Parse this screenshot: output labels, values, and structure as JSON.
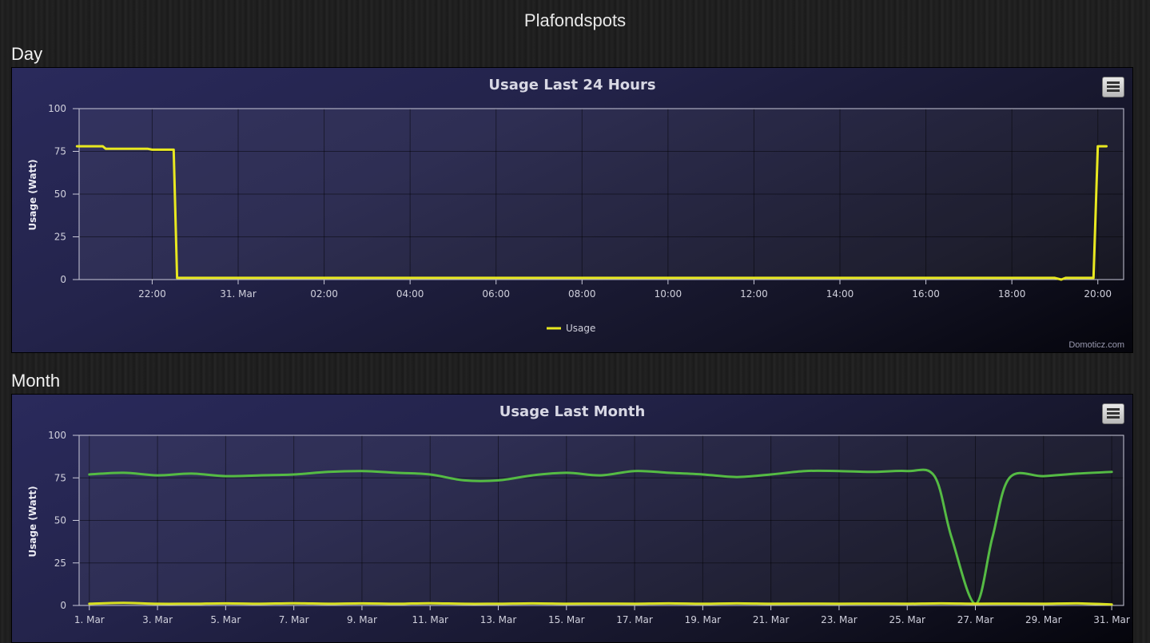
{
  "page": {
    "title": "Plafondspots"
  },
  "sections": {
    "day_label": "Day",
    "month_label": "Month"
  },
  "credit": "Domoticz.com",
  "colors": {
    "usage_day": "#e8e820",
    "usage_month_low": "#d8e020",
    "usage_month_high": "#55bb44"
  },
  "icons": {
    "menu": "hamburger-menu-icon"
  },
  "chart_data": [
    {
      "type": "line",
      "title": "Usage Last 24 Hours",
      "ylabel": "Usage (Watt)",
      "xlabel": "",
      "ylim": [
        0,
        100
      ],
      "yticks": [
        0,
        25,
        50,
        75,
        100
      ],
      "xlim_hours": [
        20.3,
        44.6
      ],
      "xticks": [
        {
          "label": "22:00",
          "hour": 22
        },
        {
          "label": "31. Mar",
          "hour": 24
        },
        {
          "label": "02:00",
          "hour": 26
        },
        {
          "label": "04:00",
          "hour": 28
        },
        {
          "label": "06:00",
          "hour": 30
        },
        {
          "label": "08:00",
          "hour": 32
        },
        {
          "label": "10:00",
          "hour": 34
        },
        {
          "label": "12:00",
          "hour": 36
        },
        {
          "label": "14:00",
          "hour": 38
        },
        {
          "label": "16:00",
          "hour": 40
        },
        {
          "label": "18:00",
          "hour": 42
        },
        {
          "label": "20:00",
          "hour": 44
        }
      ],
      "grid": true,
      "legend": "bottom-center",
      "series": [
        {
          "name": "Usage",
          "points": [
            [
              20.25,
              78
            ],
            [
              20.85,
              78
            ],
            [
              20.92,
              76.5
            ],
            [
              21.9,
              76.5
            ],
            [
              22.0,
              76
            ],
            [
              22.5,
              76
            ],
            [
              22.58,
              1
            ],
            [
              43.0,
              1
            ],
            [
              43.15,
              0
            ],
            [
              43.25,
              1
            ],
            [
              43.9,
              1
            ],
            [
              44.0,
              78
            ],
            [
              44.2,
              78
            ]
          ]
        }
      ]
    },
    {
      "type": "line",
      "title": "Usage Last Month",
      "ylabel": "Usage (Watt)",
      "xlabel": "",
      "ylim": [
        0,
        100
      ],
      "yticks": [
        0,
        25,
        50,
        75,
        100
      ],
      "xlim_days": [
        0.7,
        31.35
      ],
      "xticks": [
        {
          "label": "1. Mar",
          "day": 1
        },
        {
          "label": "3. Mar",
          "day": 3
        },
        {
          "label": "5. Mar",
          "day": 5
        },
        {
          "label": "7. Mar",
          "day": 7
        },
        {
          "label": "9. Mar",
          "day": 9
        },
        {
          "label": "11. Mar",
          "day": 11
        },
        {
          "label": "13. Mar",
          "day": 13
        },
        {
          "label": "15. Mar",
          "day": 15
        },
        {
          "label": "17. Mar",
          "day": 17
        },
        {
          "label": "19. Mar",
          "day": 19
        },
        {
          "label": "21. Mar",
          "day": 21
        },
        {
          "label": "23. Mar",
          "day": 23
        },
        {
          "label": "25. Mar",
          "day": 25
        },
        {
          "label": "27. Mar",
          "day": 27
        },
        {
          "label": "29. Mar",
          "day": 29
        },
        {
          "label": "31. Mar",
          "day": 31
        }
      ],
      "grid": true,
      "series": [
        {
          "points": [
            [
              1,
              77
            ],
            [
              2,
              78
            ],
            [
              3,
              76.5
            ],
            [
              4,
              77.5
            ],
            [
              5,
              76
            ],
            [
              6,
              76.5
            ],
            [
              7,
              77
            ],
            [
              8,
              78.5
            ],
            [
              9,
              79
            ],
            [
              10,
              78
            ],
            [
              11,
              77
            ],
            [
              12,
              73.5
            ],
            [
              13,
              73.5
            ],
            [
              14,
              76.5
            ],
            [
              15,
              78
            ],
            [
              16,
              76.5
            ],
            [
              17,
              79
            ],
            [
              18,
              78
            ],
            [
              19,
              77
            ],
            [
              20,
              75.5
            ],
            [
              21,
              77
            ],
            [
              22,
              79
            ],
            [
              23,
              79
            ],
            [
              24,
              78.5
            ],
            [
              25,
              79
            ],
            [
              25.8,
              76
            ],
            [
              26.3,
              40
            ],
            [
              27,
              1
            ],
            [
              27.5,
              40
            ],
            [
              28,
              75
            ],
            [
              29,
              76
            ],
            [
              30,
              77.5
            ],
            [
              31,
              78.5
            ]
          ]
        },
        {
          "points": [
            [
              1,
              1
            ],
            [
              2,
              1.5
            ],
            [
              3,
              1
            ],
            [
              4,
              1
            ],
            [
              5,
              1.2
            ],
            [
              6,
              1
            ],
            [
              7,
              1.3
            ],
            [
              8,
              1
            ],
            [
              9,
              1.2
            ],
            [
              10,
              1
            ],
            [
              11,
              1.3
            ],
            [
              12,
              1
            ],
            [
              13,
              1
            ],
            [
              14,
              1.2
            ],
            [
              15,
              1
            ],
            [
              16,
              1.1
            ],
            [
              17,
              1
            ],
            [
              18,
              1.2
            ],
            [
              19,
              1
            ],
            [
              20,
              1.2
            ],
            [
              21,
              1
            ],
            [
              22,
              1.1
            ],
            [
              23,
              1
            ],
            [
              24,
              1.1
            ],
            [
              25,
              1
            ],
            [
              26,
              1.2
            ],
            [
              27,
              1
            ],
            [
              28,
              1.1
            ],
            [
              29,
              1
            ],
            [
              30,
              1.2
            ],
            [
              31,
              0.6
            ]
          ]
        }
      ]
    }
  ]
}
